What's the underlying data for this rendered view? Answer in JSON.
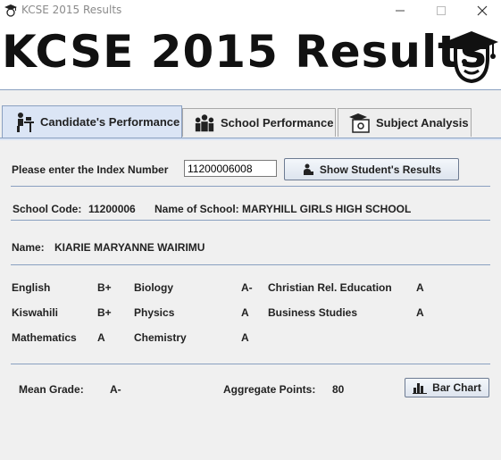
{
  "window": {
    "title": "KCSE 2015 Results"
  },
  "banner": {
    "title": "KCSE 2015 Results"
  },
  "tabs": [
    {
      "label": "Candidate's Performance"
    },
    {
      "label": "School Performance"
    },
    {
      "label": "Subject Analysis"
    }
  ],
  "search": {
    "prompt": "Please enter the Index Number",
    "value": "11200006008",
    "button": "Show Student's Results"
  },
  "school": {
    "code_label": "School Code:",
    "code": "11200006",
    "name_label": "Name of School:",
    "name": "MARYHILL GIRLS HIGH SCHOOL"
  },
  "student": {
    "name_label": "Name:",
    "name": "KIARIE MARYANNE WAIRIMU"
  },
  "subjects": [
    {
      "name": "English",
      "grade": "B+"
    },
    {
      "name": "Kiswahili",
      "grade": "B+"
    },
    {
      "name": "Mathematics",
      "grade": "A"
    },
    {
      "name": "Biology",
      "grade": "A-"
    },
    {
      "name": "Physics",
      "grade": "A"
    },
    {
      "name": "Chemistry",
      "grade": "A"
    },
    {
      "name": "Christian Rel. Education",
      "grade": "A"
    },
    {
      "name": "Business Studies",
      "grade": "A"
    }
  ],
  "summary": {
    "mean_label": "Mean Grade:",
    "mean": "A-",
    "points_label": "Aggregate Points:",
    "points": "80",
    "chart_button": "Bar Chart"
  }
}
